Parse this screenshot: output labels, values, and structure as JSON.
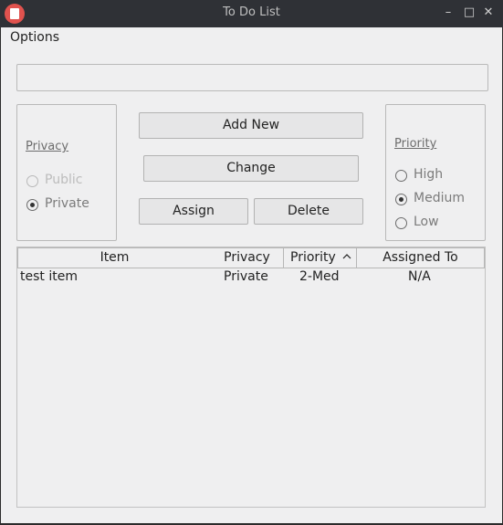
{
  "window": {
    "title": "To Do List",
    "app_icon": "todo-app-icon",
    "minimize_icon": "minimize-icon",
    "maximize_icon": "maximize-icon",
    "close_icon": "close-icon"
  },
  "menu": {
    "options_label": "Options"
  },
  "new_item_input": {
    "value": "",
    "placeholder": ""
  },
  "privacy_group": {
    "title": "Privacy",
    "options": [
      {
        "label": "Public",
        "selected": false,
        "enabled": false
      },
      {
        "label": "Private",
        "selected": true,
        "enabled": true
      }
    ]
  },
  "buttons": {
    "add_new": "Add New",
    "change": "Change",
    "assign": "Assign",
    "delete": "Delete"
  },
  "priority_group": {
    "title": "Priority",
    "options": [
      {
        "label": "High",
        "selected": false
      },
      {
        "label": "Medium",
        "selected": true
      },
      {
        "label": "Low",
        "selected": false
      }
    ]
  },
  "table": {
    "columns": [
      "Item",
      "Privacy",
      "Priority",
      "Assigned To"
    ],
    "sort_column": "Priority",
    "sort_icon": "sort-ascending-icon",
    "rows": [
      {
        "item": "test item",
        "privacy": "Private",
        "priority": "2-Med",
        "assigned_to": "N/A"
      }
    ]
  }
}
